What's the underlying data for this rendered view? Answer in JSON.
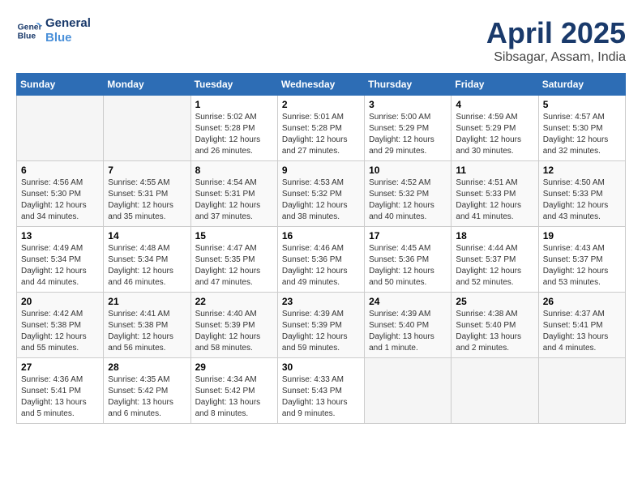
{
  "header": {
    "logo_line1": "General",
    "logo_line2": "Blue",
    "month": "April 2025",
    "location": "Sibsagar, Assam, India"
  },
  "days_of_week": [
    "Sunday",
    "Monday",
    "Tuesday",
    "Wednesday",
    "Thursday",
    "Friday",
    "Saturday"
  ],
  "weeks": [
    [
      null,
      null,
      {
        "day": 1,
        "sunrise": "5:02 AM",
        "sunset": "5:28 PM",
        "daylight": "12 hours and 26 minutes."
      },
      {
        "day": 2,
        "sunrise": "5:01 AM",
        "sunset": "5:28 PM",
        "daylight": "12 hours and 27 minutes."
      },
      {
        "day": 3,
        "sunrise": "5:00 AM",
        "sunset": "5:29 PM",
        "daylight": "12 hours and 29 minutes."
      },
      {
        "day": 4,
        "sunrise": "4:59 AM",
        "sunset": "5:29 PM",
        "daylight": "12 hours and 30 minutes."
      },
      {
        "day": 5,
        "sunrise": "4:57 AM",
        "sunset": "5:30 PM",
        "daylight": "12 hours and 32 minutes."
      }
    ],
    [
      {
        "day": 6,
        "sunrise": "4:56 AM",
        "sunset": "5:30 PM",
        "daylight": "12 hours and 34 minutes."
      },
      {
        "day": 7,
        "sunrise": "4:55 AM",
        "sunset": "5:31 PM",
        "daylight": "12 hours and 35 minutes."
      },
      {
        "day": 8,
        "sunrise": "4:54 AM",
        "sunset": "5:31 PM",
        "daylight": "12 hours and 37 minutes."
      },
      {
        "day": 9,
        "sunrise": "4:53 AM",
        "sunset": "5:32 PM",
        "daylight": "12 hours and 38 minutes."
      },
      {
        "day": 10,
        "sunrise": "4:52 AM",
        "sunset": "5:32 PM",
        "daylight": "12 hours and 40 minutes."
      },
      {
        "day": 11,
        "sunrise": "4:51 AM",
        "sunset": "5:33 PM",
        "daylight": "12 hours and 41 minutes."
      },
      {
        "day": 12,
        "sunrise": "4:50 AM",
        "sunset": "5:33 PM",
        "daylight": "12 hours and 43 minutes."
      }
    ],
    [
      {
        "day": 13,
        "sunrise": "4:49 AM",
        "sunset": "5:34 PM",
        "daylight": "12 hours and 44 minutes."
      },
      {
        "day": 14,
        "sunrise": "4:48 AM",
        "sunset": "5:34 PM",
        "daylight": "12 hours and 46 minutes."
      },
      {
        "day": 15,
        "sunrise": "4:47 AM",
        "sunset": "5:35 PM",
        "daylight": "12 hours and 47 minutes."
      },
      {
        "day": 16,
        "sunrise": "4:46 AM",
        "sunset": "5:36 PM",
        "daylight": "12 hours and 49 minutes."
      },
      {
        "day": 17,
        "sunrise": "4:45 AM",
        "sunset": "5:36 PM",
        "daylight": "12 hours and 50 minutes."
      },
      {
        "day": 18,
        "sunrise": "4:44 AM",
        "sunset": "5:37 PM",
        "daylight": "12 hours and 52 minutes."
      },
      {
        "day": 19,
        "sunrise": "4:43 AM",
        "sunset": "5:37 PM",
        "daylight": "12 hours and 53 minutes."
      }
    ],
    [
      {
        "day": 20,
        "sunrise": "4:42 AM",
        "sunset": "5:38 PM",
        "daylight": "12 hours and 55 minutes."
      },
      {
        "day": 21,
        "sunrise": "4:41 AM",
        "sunset": "5:38 PM",
        "daylight": "12 hours and 56 minutes."
      },
      {
        "day": 22,
        "sunrise": "4:40 AM",
        "sunset": "5:39 PM",
        "daylight": "12 hours and 58 minutes."
      },
      {
        "day": 23,
        "sunrise": "4:39 AM",
        "sunset": "5:39 PM",
        "daylight": "12 hours and 59 minutes."
      },
      {
        "day": 24,
        "sunrise": "4:39 AM",
        "sunset": "5:40 PM",
        "daylight": "13 hours and 1 minute."
      },
      {
        "day": 25,
        "sunrise": "4:38 AM",
        "sunset": "5:40 PM",
        "daylight": "13 hours and 2 minutes."
      },
      {
        "day": 26,
        "sunrise": "4:37 AM",
        "sunset": "5:41 PM",
        "daylight": "13 hours and 4 minutes."
      }
    ],
    [
      {
        "day": 27,
        "sunrise": "4:36 AM",
        "sunset": "5:41 PM",
        "daylight": "13 hours and 5 minutes."
      },
      {
        "day": 28,
        "sunrise": "4:35 AM",
        "sunset": "5:42 PM",
        "daylight": "13 hours and 6 minutes."
      },
      {
        "day": 29,
        "sunrise": "4:34 AM",
        "sunset": "5:42 PM",
        "daylight": "13 hours and 8 minutes."
      },
      {
        "day": 30,
        "sunrise": "4:33 AM",
        "sunset": "5:43 PM",
        "daylight": "13 hours and 9 minutes."
      },
      null,
      null,
      null
    ]
  ]
}
